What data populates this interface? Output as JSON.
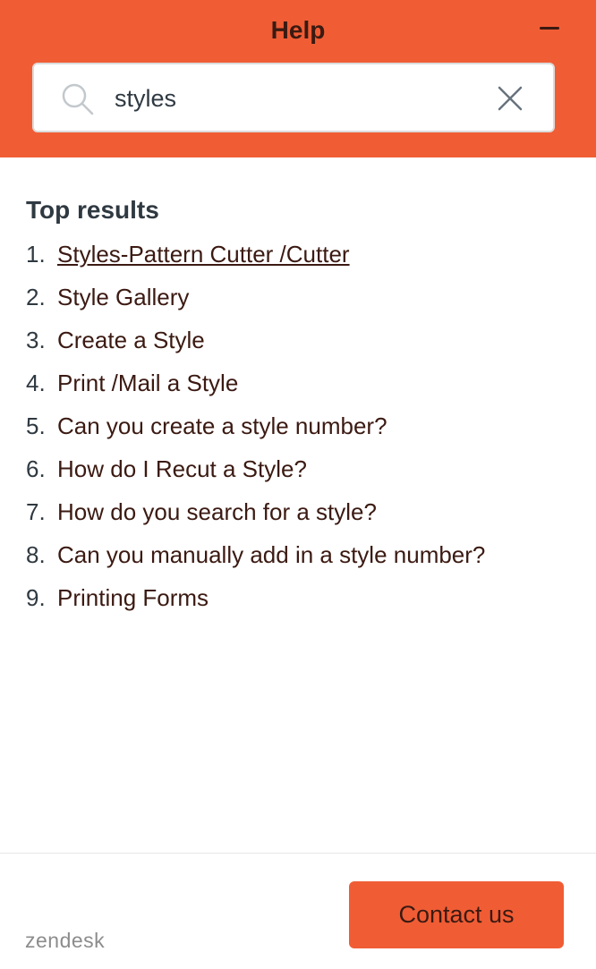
{
  "header": {
    "title": "Help",
    "minimize_icon": "minus-icon",
    "background_color": "#f05d35",
    "text_color": "#3b1a12"
  },
  "search": {
    "value": "styles",
    "search_icon": "search-icon",
    "clear_icon": "close-icon"
  },
  "results": {
    "heading": "Top results",
    "items": [
      {
        "number": "1.",
        "label": "Styles-Pattern Cutter /Cutter"
      },
      {
        "number": "2.",
        "label": "Style Gallery"
      },
      {
        "number": "3.",
        "label": "Create a Style"
      },
      {
        "number": "4.",
        "label": "Print /Mail a Style"
      },
      {
        "number": "5.",
        "label": "Can you create a style number?"
      },
      {
        "number": "6.",
        "label": "How do I Recut a Style?"
      },
      {
        "number": "7.",
        "label": "How do you search for a style?"
      },
      {
        "number": "8.",
        "label": "Can you manually add in a style number?"
      },
      {
        "number": "9.",
        "label": "Printing Forms"
      }
    ]
  },
  "footer": {
    "brand": "zendesk",
    "contact_label": "Contact us",
    "button_color": "#f05d35"
  }
}
